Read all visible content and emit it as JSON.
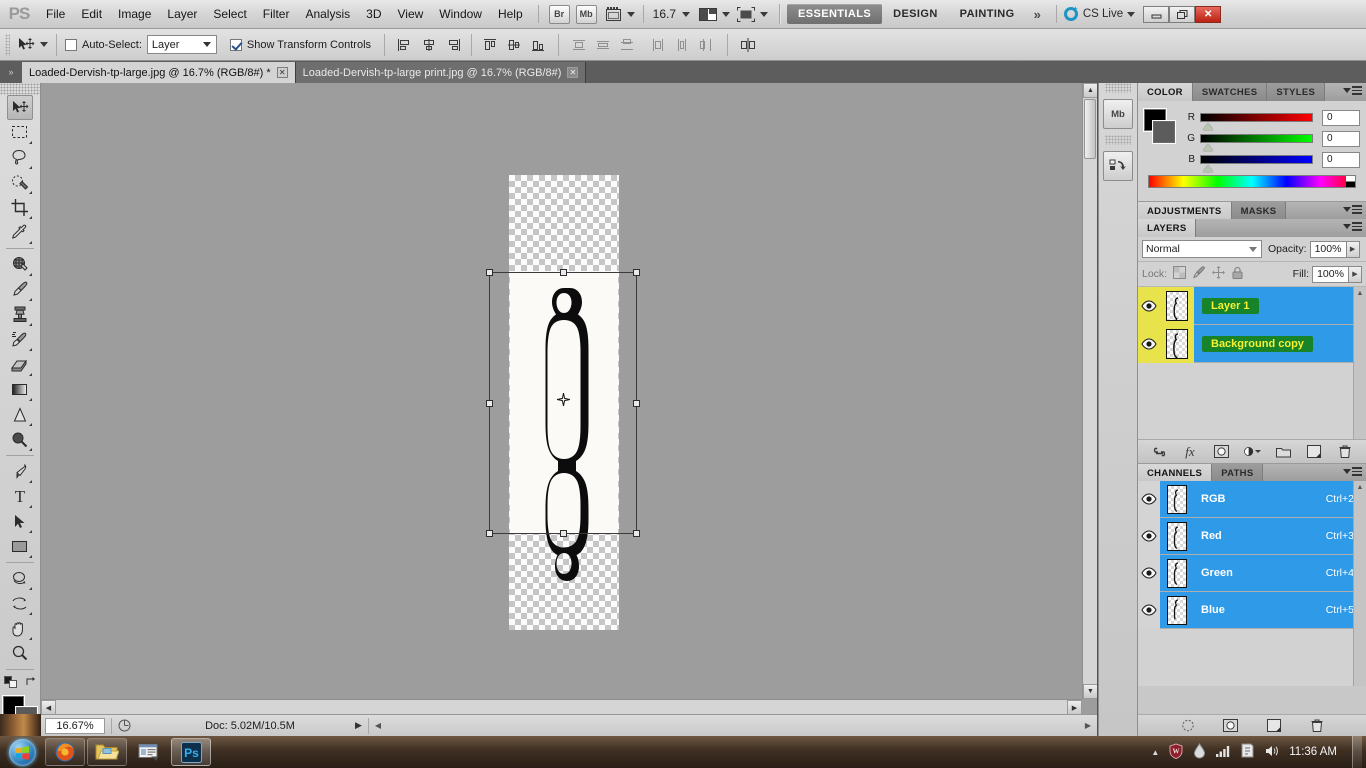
{
  "app": {
    "name": "Adobe Photoshop CS5",
    "logo": "PS"
  },
  "menubar": {
    "items": [
      "File",
      "Edit",
      "Image",
      "Layer",
      "Select",
      "Filter",
      "Analysis",
      "3D",
      "View",
      "Window",
      "Help"
    ],
    "bridge_label": "Br",
    "minibridge_label": "Mb",
    "zoom_value": "16.7",
    "workspaces": [
      "ESSENTIALS",
      "DESIGN",
      "PAINTING"
    ],
    "active_workspace": "ESSENTIALS",
    "more_workspaces": "»",
    "cs_live_label": "CS Live",
    "window_buttons": {
      "minimize": "—",
      "restore": "❐",
      "close": "✕"
    }
  },
  "options_bar": {
    "tool_icon": "move-tool",
    "auto_select_label": "Auto-Select:",
    "auto_select_checked": false,
    "auto_select_value": "Layer",
    "show_transform_label": "Show Transform Controls",
    "show_transform_checked": true,
    "align_group_1": [
      "align-left-edges",
      "align-horizontal-centers",
      "align-right-edges"
    ],
    "align_group_2": [
      "align-top-edges",
      "align-vertical-centers",
      "align-bottom-edges"
    ],
    "distribute_group_1": [
      "distribute-top-edges",
      "distribute-vertical-centers",
      "distribute-bottom-edges"
    ],
    "distribute_group_2": [
      "distribute-left-edges",
      "distribute-horizontal-centers",
      "distribute-right-edges"
    ],
    "auto_align_label": "auto-align-layers"
  },
  "document_tabs": [
    {
      "title": "Loaded-Dervish-tp-large.jpg @ 16.7% (RGB/8#) *",
      "active": true,
      "close": "✕"
    },
    {
      "title": "Loaded-Dervish-tp-large print.jpg @ 16.7% (RGB/8#)",
      "active": false,
      "close": "✕"
    }
  ],
  "toolbox": {
    "tools": [
      {
        "name": "move-tool",
        "selected": true,
        "has_flyout": false
      },
      {
        "name": "rectangular-marquee-tool",
        "selected": false,
        "has_flyout": true
      },
      {
        "name": "lasso-tool",
        "selected": false,
        "has_flyout": true
      },
      {
        "name": "quick-selection-tool",
        "selected": false,
        "has_flyout": true
      },
      {
        "name": "crop-tool",
        "selected": false,
        "has_flyout": true
      },
      {
        "name": "eyedropper-tool",
        "selected": false,
        "has_flyout": true
      },
      {
        "name": "spot-healing-brush-tool",
        "selected": false,
        "has_flyout": true
      },
      {
        "name": "brush-tool",
        "selected": false,
        "has_flyout": true
      },
      {
        "name": "clone-stamp-tool",
        "selected": false,
        "has_flyout": true
      },
      {
        "name": "history-brush-tool",
        "selected": false,
        "has_flyout": true
      },
      {
        "name": "eraser-tool",
        "selected": false,
        "has_flyout": true
      },
      {
        "name": "gradient-tool",
        "selected": false,
        "has_flyout": true
      },
      {
        "name": "blur-tool",
        "selected": false,
        "has_flyout": true
      },
      {
        "name": "dodge-tool",
        "selected": false,
        "has_flyout": true
      },
      {
        "name": "pen-tool",
        "selected": false,
        "has_flyout": true
      },
      {
        "name": "horizontal-type-tool",
        "selected": false,
        "has_flyout": true
      },
      {
        "name": "path-selection-tool",
        "selected": false,
        "has_flyout": true
      },
      {
        "name": "rectangle-tool",
        "selected": false,
        "has_flyout": true
      },
      {
        "name": "3d-object-rotate-tool",
        "selected": false,
        "has_flyout": true
      },
      {
        "name": "3d-camera-rotate-tool",
        "selected": false,
        "has_flyout": true
      },
      {
        "name": "hand-tool",
        "selected": false,
        "has_flyout": true
      },
      {
        "name": "zoom-tool",
        "selected": false,
        "has_flyout": false
      }
    ],
    "foreground_color": "#000000",
    "background_color": "#5a5a5a",
    "quick_mask_label": "edit-in-quick-mask-mode"
  },
  "canvas": {
    "artwork": "skateboard-deck-outline",
    "transparent_background": true,
    "transform_active": true,
    "center_marker": "transform-reference-point"
  },
  "status_bar": {
    "zoom": "16.67%",
    "doc_info": "Doc: 5.02M/10.5M",
    "arrow": "▶"
  },
  "dock_strip": {
    "items": [
      {
        "name": "mini-bridge-panel",
        "label": "Mb"
      },
      {
        "name": "history-panel",
        "label": ""
      }
    ]
  },
  "color_panel": {
    "tabs": [
      {
        "label": "COLOR",
        "active": true
      },
      {
        "label": "SWATCHES",
        "active": false
      },
      {
        "label": "STYLES",
        "active": false
      }
    ],
    "foreground": "#000000",
    "background": "#5c5c5c",
    "channels": [
      {
        "label": "R",
        "value": "0",
        "ramp_end": "#ff0000"
      },
      {
        "label": "G",
        "value": "0",
        "ramp_end": "#00ff00"
      },
      {
        "label": "B",
        "value": "0",
        "ramp_end": "#0000ff"
      }
    ]
  },
  "adjustments_panel": {
    "tabs": [
      {
        "label": "ADJUSTMENTS",
        "active": true
      },
      {
        "label": "MASKS",
        "active": false
      }
    ]
  },
  "layers_panel": {
    "tabs": [
      {
        "label": "LAYERS",
        "active": true
      }
    ],
    "blend_mode": "Normal",
    "opacity_label": "Opacity:",
    "opacity_value": "100%",
    "lock_label": "Lock:",
    "lock_icons": [
      "lock-transparent-pixels",
      "lock-image-pixels",
      "lock-position",
      "lock-all"
    ],
    "fill_label": "Fill:",
    "fill_value": "100%",
    "layers": [
      {
        "name": "Layer 1",
        "visible": true,
        "selected": true,
        "highlighted": true
      },
      {
        "name": "Background copy",
        "visible": true,
        "selected": true,
        "highlighted": true
      }
    ],
    "bottom_buttons": [
      "link-layers-icon",
      "add-layer-style-icon",
      "add-layer-mask-icon",
      "new-adjustment-layer-icon",
      "new-group-icon",
      "new-layer-icon",
      "delete-layer-icon"
    ]
  },
  "channels_panel": {
    "tabs": [
      {
        "label": "CHANNELS",
        "active": true
      },
      {
        "label": "PATHS",
        "active": false
      }
    ],
    "channels": [
      {
        "name": "RGB",
        "shortcut": "Ctrl+2",
        "visible": true,
        "selected": true
      },
      {
        "name": "Red",
        "shortcut": "Ctrl+3",
        "visible": true,
        "selected": true
      },
      {
        "name": "Green",
        "shortcut": "Ctrl+4",
        "visible": true,
        "selected": true
      },
      {
        "name": "Blue",
        "shortcut": "Ctrl+5",
        "visible": true,
        "selected": true
      }
    ],
    "bottom_buttons": [
      "load-channel-as-selection-icon",
      "save-selection-as-channel-icon",
      "new-channel-icon",
      "delete-channel-icon"
    ]
  },
  "taskbar": {
    "start_label": "start-orb",
    "items": [
      {
        "name": "firefox-taskbar-item"
      },
      {
        "name": "file-explorer-taskbar-item"
      },
      {
        "name": "media-taskbar-item"
      },
      {
        "name": "photoshop-taskbar-item",
        "label": "Ps",
        "active": true
      }
    ],
    "tray": [
      {
        "name": "show-hidden-icons-arrow",
        "glyph": "▲"
      },
      {
        "name": "antivirus-tray-icon",
        "glyph": "⛨"
      },
      {
        "name": "dropbox-tray-icon",
        "glyph": "◆"
      },
      {
        "name": "network-tray-icon",
        "glyph": "█"
      },
      {
        "name": "action-center-tray-icon",
        "glyph": "⚑"
      },
      {
        "name": "volume-tray-icon",
        "glyph": "◂"
      }
    ],
    "clock": "11:36 AM",
    "show_desktop": "show-desktop-button"
  },
  "colors": {
    "selection_blue": "#2f9ae8",
    "highlight_yellow": "#e8e34a",
    "highlight_green": "#17842a",
    "layer_name_text": "#f5f131"
  }
}
